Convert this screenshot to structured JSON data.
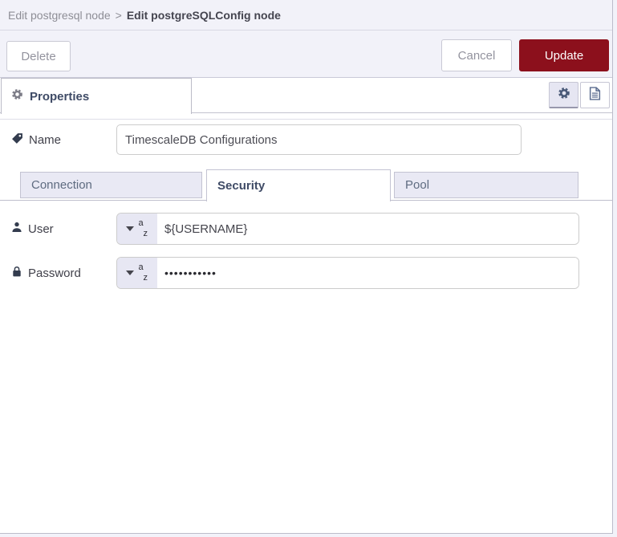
{
  "breadcrumb": {
    "parent": "Edit postgresql node",
    "separator": ">",
    "current": "Edit postgreSQLConfig node"
  },
  "actions": {
    "delete_label": "Delete",
    "cancel_label": "Cancel",
    "update_label": "Update"
  },
  "properties_bar": {
    "tab_label": "Properties",
    "tab_icon": "gear-icon",
    "buttons": [
      {
        "name": "node-settings-button",
        "icon": "gear-icon",
        "selected": true
      },
      {
        "name": "node-description-button",
        "icon": "document-icon",
        "selected": false
      }
    ]
  },
  "form": {
    "name_field": {
      "label": "Name",
      "icon": "tag-icon",
      "value": "TimescaleDB Configurations"
    },
    "tabs": [
      {
        "label": "Connection",
        "active": false
      },
      {
        "label": "Security",
        "active": true
      },
      {
        "label": "Pool",
        "active": false
      }
    ],
    "user_field": {
      "label": "User",
      "icon": "person-icon",
      "type_icon": "az-string-type",
      "type_a": "a",
      "type_z": "z",
      "value": "${USERNAME}"
    },
    "password_field": {
      "label": "Password",
      "icon": "lock-icon",
      "type_icon": "az-string-type",
      "type_a": "a",
      "type_z": "z",
      "value": "•••••••••••"
    }
  },
  "colors": {
    "update_button": "#8c101c",
    "panel_background": "#f2f2f9",
    "inactive_tab_background": "#e9e9f4",
    "selected_icon_button_background": "#e6e6f2",
    "border": "#c3c3d2"
  }
}
